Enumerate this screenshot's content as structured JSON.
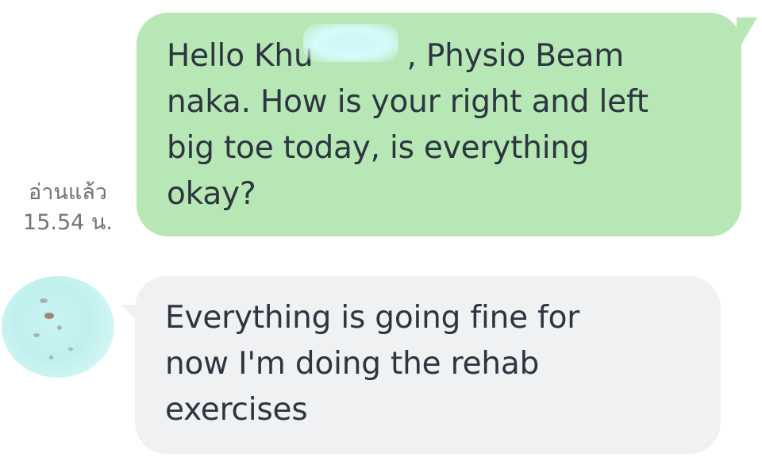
{
  "conversation": {
    "sent_message": {
      "lines": [
        "Hello Khu",
        "naka. How is your right and left",
        "big toe today, is everything",
        "okay?"
      ],
      "line1_suffix": ", Physio Beam",
      "read_status": "อ่านแล้ว",
      "time": "15.54 น."
    },
    "received_message": {
      "lines": [
        "Everything is going fine for",
        "now I'm doing the rehab",
        "exercises"
      ]
    }
  },
  "colors": {
    "sent_bubble": "#b7e7b5",
    "received_bubble": "#eff1f3",
    "text": "#2c3540",
    "meta_text": "#6d737a"
  }
}
